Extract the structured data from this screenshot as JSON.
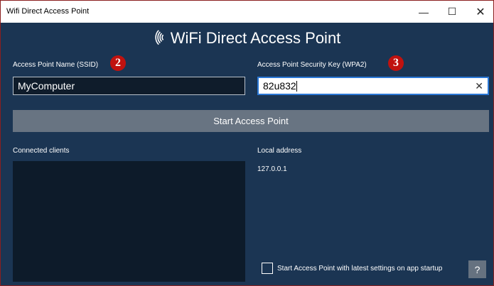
{
  "window": {
    "title": "Wifi Direct Access Point",
    "controls": {
      "minimize": "—",
      "maximize": "☐",
      "close": "✕"
    }
  },
  "header": {
    "icon": "wifi-icon",
    "title": "WiFi Direct Access Point"
  },
  "ssid": {
    "label": "Access Point Name (SSID)",
    "value": "MyComputer",
    "badge": "2"
  },
  "key": {
    "label": "Access Point Security Key (WPA2)",
    "value": "82u832",
    "badge": "3",
    "clear_glyph": "✕"
  },
  "start_button": {
    "label": "Start Access Point"
  },
  "clients": {
    "label": "Connected clients"
  },
  "local": {
    "label": "Local address",
    "value": "127.0.0.1"
  },
  "startup_option": {
    "label": "Start Access Point with latest settings on app startup",
    "checked": false
  },
  "help_button": {
    "label": "?"
  },
  "colors": {
    "background": "#1b3553",
    "badge": "#c0120f",
    "button": "#687482",
    "focus_border": "#2b78d6"
  }
}
